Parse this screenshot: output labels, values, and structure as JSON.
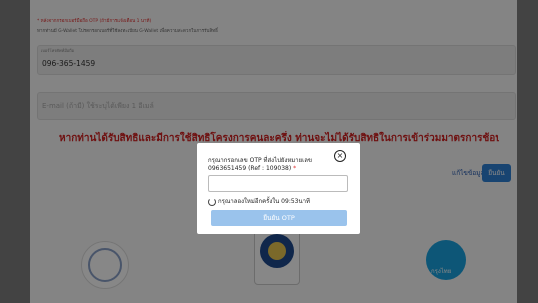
{
  "form": {
    "otp_note": "* หลังจากกรอกเบอร์มือถือ OTP (ถ้ามีการแจ้งเตือน 1 นาที)",
    "gwallet_note": "หากท่านมี G-Wallet โปรดกรอกเบอร์ที่ใช้ลงทะเบียน G-Wallet เพื่อความสะดวกในการรับสิทธิ์",
    "phone_label": "เบอร์โทรศัพท์มือถือ",
    "phone_value": "096-365-1459",
    "email_placeholder": "E-mail (ถ้ามี) ใช้ระบุได้เพียง 1 อีเมล์",
    "warning": "หากท่านได้รับสิทธิและมีการใช้สิทธิโครงการคนละครึ่ง ท่านจะไม่ได้รับสิทธิในการเข้าร่วมมาตรการช้อปดีมีคืน",
    "edit_link": "แก้ไขข้อมูล",
    "confirm_button": "ยืนยัน"
  },
  "logos": {
    "right_text": "กรุงไทย"
  },
  "modal": {
    "line1": "กรุณากรอกเลข OTP ที่ส่งไปยังหมายเลข",
    "line2": "0963651459 (Ref : 109038)",
    "required_mark": "*",
    "otp_value": "",
    "resend_text": "กรุณาลองใหม่อีกครั้งใน 09:53นาที",
    "confirm_otp_button": "ยืนยัน OTP"
  },
  "colors": {
    "warning": "#d12020",
    "primary": "#2f80d6",
    "otp_button_disabled": "#9ac3ec"
  }
}
